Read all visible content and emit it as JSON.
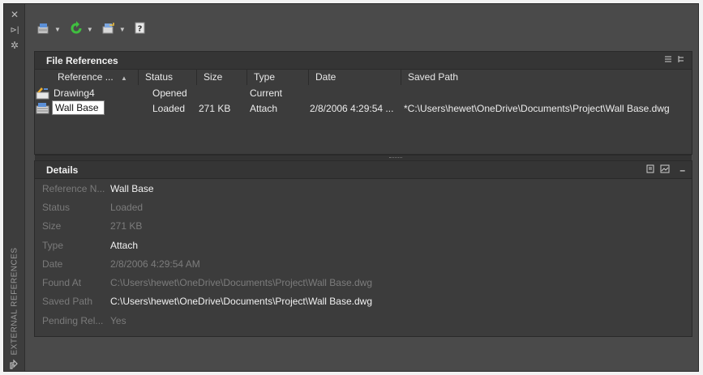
{
  "strip": {
    "label": "EXTERNAL REFERENCES",
    "icons": [
      "close-icon",
      "pin-icon",
      "settings-icon",
      "palette-corner-icon"
    ]
  },
  "toolbar": {
    "buttons": [
      {
        "name": "attach-dwg-icon"
      },
      {
        "name": "refresh-icon"
      },
      {
        "name": "change-path-icon"
      },
      {
        "name": "help-icon"
      }
    ]
  },
  "file_references": {
    "title": "File References",
    "view_icons": [
      "list-view-icon",
      "tree-view-icon"
    ],
    "columns": [
      "Reference ...",
      "Status",
      "Size",
      "Type",
      "Date",
      "Saved Path"
    ],
    "rows": [
      {
        "name": "Drawing4",
        "status": "Opened",
        "size": "",
        "type": "Current",
        "date": "",
        "saved_path": ""
      },
      {
        "name": "Wall Base",
        "status": "Loaded",
        "size": "271 KB",
        "type": "Attach",
        "date": "2/8/2006 4:29:54 ...",
        "saved_path": "*C:\\Users\\hewet\\OneDrive\\Documents\\Project\\Wall Base.dwg"
      }
    ]
  },
  "details": {
    "title": "Details",
    "collapse_glyph": "–",
    "fields": [
      {
        "label": "Reference N...",
        "value": "Wall Base",
        "emphasis": true
      },
      {
        "label": "Status",
        "value": "Loaded",
        "emphasis": false
      },
      {
        "label": "Size",
        "value": "271 KB",
        "emphasis": false
      },
      {
        "label": "Type",
        "value": "Attach",
        "emphasis": true
      },
      {
        "label": "Date",
        "value": "2/8/2006 4:29:54 AM",
        "emphasis": false
      },
      {
        "label": "Found At",
        "value": "C:\\Users\\hewet\\OneDrive\\Documents\\Project\\Wall Base.dwg",
        "emphasis": false
      },
      {
        "label": "Saved Path",
        "value": "C:\\Users\\hewet\\OneDrive\\Documents\\Project\\Wall Base.dwg",
        "emphasis": true
      },
      {
        "label": "Pending Rel...",
        "value": "Yes",
        "emphasis": false
      }
    ]
  }
}
